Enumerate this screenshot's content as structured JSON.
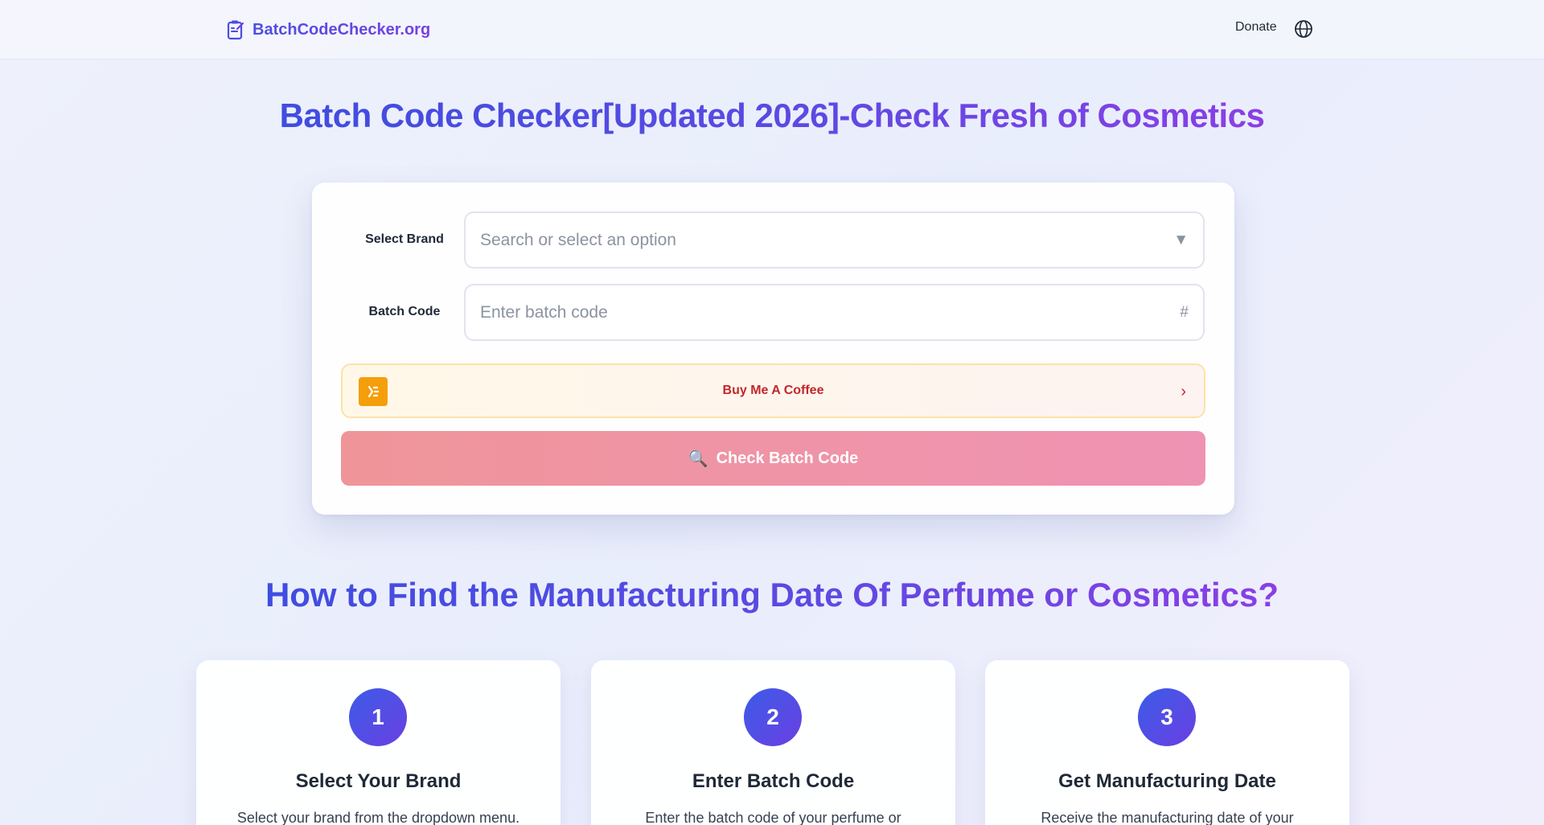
{
  "header": {
    "brand": "BatchCodeChecker.org",
    "donate": "Donate",
    "icons": {
      "logo": "clipboard-icon",
      "language": "globe-icon"
    }
  },
  "hero": {
    "title_part1": "Batch Code Checker[Updated 2026]-Check Fresh of Cosmetics"
  },
  "form": {
    "brand_label": "Select Brand",
    "brand_placeholder": "Search or select an option",
    "brand_arrow": "▼",
    "batch_label": "Batch Code",
    "batch_placeholder": "Enter batch code",
    "batch_suffix": "#",
    "coffee_label": "Buy Me A Coffee",
    "coffee_chevron": "›",
    "check_button": "Check Batch Code",
    "check_icon": "🔍"
  },
  "howto": {
    "title": "How to Find the Manufacturing Date Of Perfume or Cosmetics?",
    "steps": [
      {
        "number": "1",
        "title": "Select Your Brand",
        "desc": "Select your brand from the dropdown menu."
      },
      {
        "number": "2",
        "title": "Enter Batch Code",
        "desc": "Enter the batch code of your perfume or"
      },
      {
        "number": "3",
        "title": "Get Manufacturing Date",
        "desc": "Receive the manufacturing date of your"
      }
    ]
  },
  "colors": {
    "accent_start": "#3f4de0",
    "accent_end": "#8a3fe6",
    "button_start": "#ef9599",
    "button_end": "#ef93b4",
    "coffee_text": "#c2272d",
    "coffee_icon_bg": "#f59e0b"
  }
}
